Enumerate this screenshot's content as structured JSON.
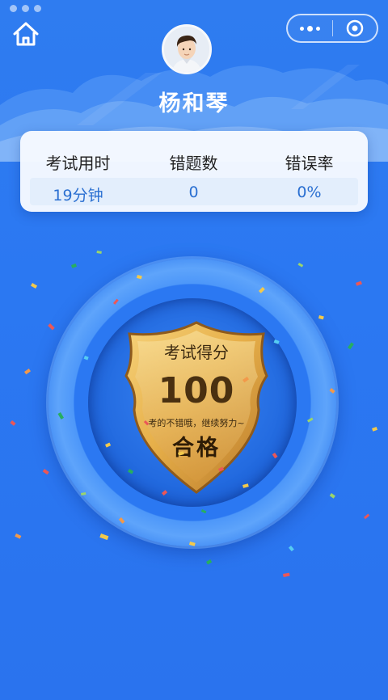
{
  "nav": {
    "home_icon": "home-icon",
    "more_icon": "more-dots-icon",
    "close_icon": "target-close-icon"
  },
  "user": {
    "name": "杨和琴",
    "avatar_icon": "avatar-boy-icon"
  },
  "stats": [
    {
      "label": "考试用时",
      "value": "19分钟"
    },
    {
      "label": "错题数",
      "value": "0"
    },
    {
      "label": "错误率",
      "value": "0%"
    }
  ],
  "score": {
    "title": "考试得分",
    "value": "100",
    "message": "考的不错哦，继续努力~",
    "result": "合格"
  },
  "colors": {
    "background": "#2b78f2",
    "accent_text": "#2a6fd1",
    "badge_gold": "#e9b44c"
  }
}
